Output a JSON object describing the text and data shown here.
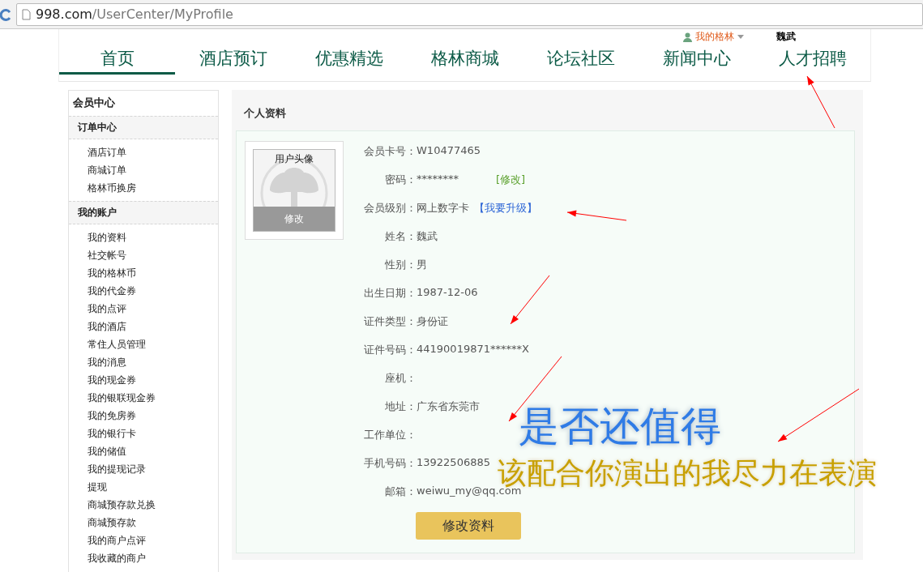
{
  "browser": {
    "url_host": "998.com",
    "url_path": "/UserCenter/MyProfile"
  },
  "header": {
    "user_menu": "我的格林",
    "user_name": "魏武"
  },
  "nav": [
    {
      "label": "首页",
      "selected": true
    },
    {
      "label": "酒店预订",
      "selected": false
    },
    {
      "label": "优惠精选",
      "selected": false
    },
    {
      "label": "格林商城",
      "selected": false
    },
    {
      "label": "论坛社区",
      "selected": false
    },
    {
      "label": "新闻中心",
      "selected": false
    },
    {
      "label": "人才招聘",
      "selected": false
    }
  ],
  "sidebar": {
    "title": "会员中心",
    "sections": [
      {
        "heading": "订单中心",
        "items": [
          "酒店订单",
          "商城订单",
          "格林币换房"
        ]
      },
      {
        "heading": "我的账户",
        "items": [
          "我的资料",
          "社交帐号",
          "我的格林币",
          "我的代金券",
          "我的点评",
          "我的酒店",
          "常住人员管理",
          "我的消息",
          "我的现金券",
          "我的银联现金券",
          "我的免房券",
          "我的银行卡",
          "我的储值",
          "我的提现记录",
          "提现",
          "商城预存款兑换",
          "商城预存款",
          "我的商户点评",
          "我收藏的商户"
        ]
      }
    ]
  },
  "profile": {
    "title": "个人资料",
    "avatar": {
      "caption": "用户头像",
      "edit": "修改"
    },
    "fields": [
      {
        "label": "会员卡号：",
        "value": "W10477465"
      },
      {
        "label": "密码：",
        "value": "********",
        "link": {
          "kind": "edit",
          "text": "[修改]"
        }
      },
      {
        "label": "会员级别：",
        "value": "网上数字卡",
        "link": {
          "kind": "upgrade",
          "text": "【我要升级】"
        }
      },
      {
        "label": "姓名：",
        "value": "魏武"
      },
      {
        "label": "性别：",
        "value": "男"
      },
      {
        "label": "出生日期：",
        "value": "1987-12-06"
      },
      {
        "label": "证件类型：",
        "value": "身份证"
      },
      {
        "label": "证件号码：",
        "value": "44190019871******X"
      },
      {
        "label": "座机："
      },
      {
        "label": "地址：",
        "value": "广东省东莞市"
      },
      {
        "label": "工作单位："
      },
      {
        "label": "手机号码：",
        "value": "13922506885"
      },
      {
        "label": "邮箱：",
        "value": "weiwu_my@qq.com"
      }
    ],
    "submit": "修改资料"
  },
  "annotations": [
    {
      "kind": "title",
      "text": "是否还值得"
    },
    {
      "kind": "subtitle",
      "text": "该配合你演出的我尽力在表演"
    }
  ]
}
